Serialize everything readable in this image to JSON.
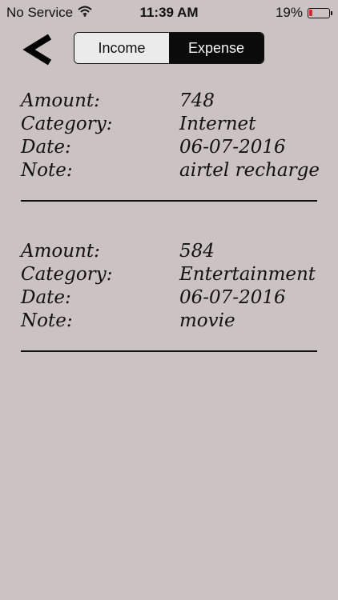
{
  "status_bar": {
    "carrier": "No Service",
    "time": "11:39 AM",
    "battery_percent": "19%",
    "battery_level": 0.19,
    "battery_color": "#e8232a"
  },
  "nav": {
    "back_icon": "chevron-left-icon",
    "segments": [
      {
        "label": "Income",
        "selected": false
      },
      {
        "label": "Expense",
        "selected": true
      }
    ]
  },
  "records": [
    {
      "amount_label": "Amount:",
      "amount": "748",
      "category_label": "Category:",
      "category": "Internet",
      "date_label": "Date:",
      "date": "06-07-2016",
      "note_label": "Note:",
      "note": "airtel recharge"
    },
    {
      "amount_label": "Amount:",
      "amount": "584",
      "category_label": "Category:",
      "category": "Entertainment",
      "date_label": "Date:",
      "date": "06-07-2016",
      "note_label": "Note:",
      "note": "movie"
    }
  ],
  "colors": {
    "background": "#cbc2c4",
    "selected_segment": "#0b0b0b"
  }
}
